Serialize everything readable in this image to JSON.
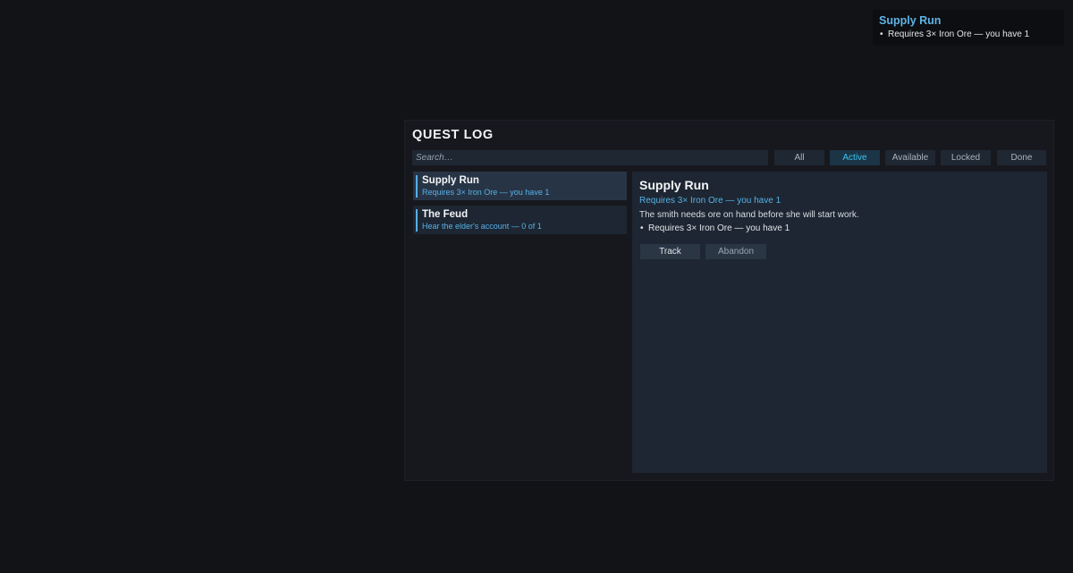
{
  "tracker": {
    "title": "Supply Run",
    "objective": "Requires 3× Iron Ore — you have 1"
  },
  "quest_log": {
    "title": "QUEST LOG",
    "search_placeholder": "Search…",
    "filters": [
      {
        "label": "All",
        "active": false
      },
      {
        "label": "Active",
        "active": true
      },
      {
        "label": "Available",
        "active": false
      },
      {
        "label": "Locked",
        "active": false
      },
      {
        "label": "Done",
        "active": false
      }
    ],
    "quests": [
      {
        "name": "Supply Run",
        "subtitle": "Requires 3× Iron Ore — you have 1",
        "selected": true
      },
      {
        "name": "The Feud",
        "subtitle": "Hear the elder's account — 0 of 1",
        "selected": false
      }
    ],
    "detail": {
      "title": "Supply Run",
      "requirement": "Requires 3× Iron Ore — you have 1",
      "description": "The smith needs ore on hand before she will start work.",
      "objective": "Requires 3× Iron Ore — you have 1",
      "track_label": "Track",
      "abandon_label": "Abandon"
    }
  },
  "colors": {
    "accent": "#39c5ee",
    "link_blue": "#57b2e8",
    "panel_bg": "#1d2632",
    "page_bg": "#121316"
  },
  "bullet": "•"
}
